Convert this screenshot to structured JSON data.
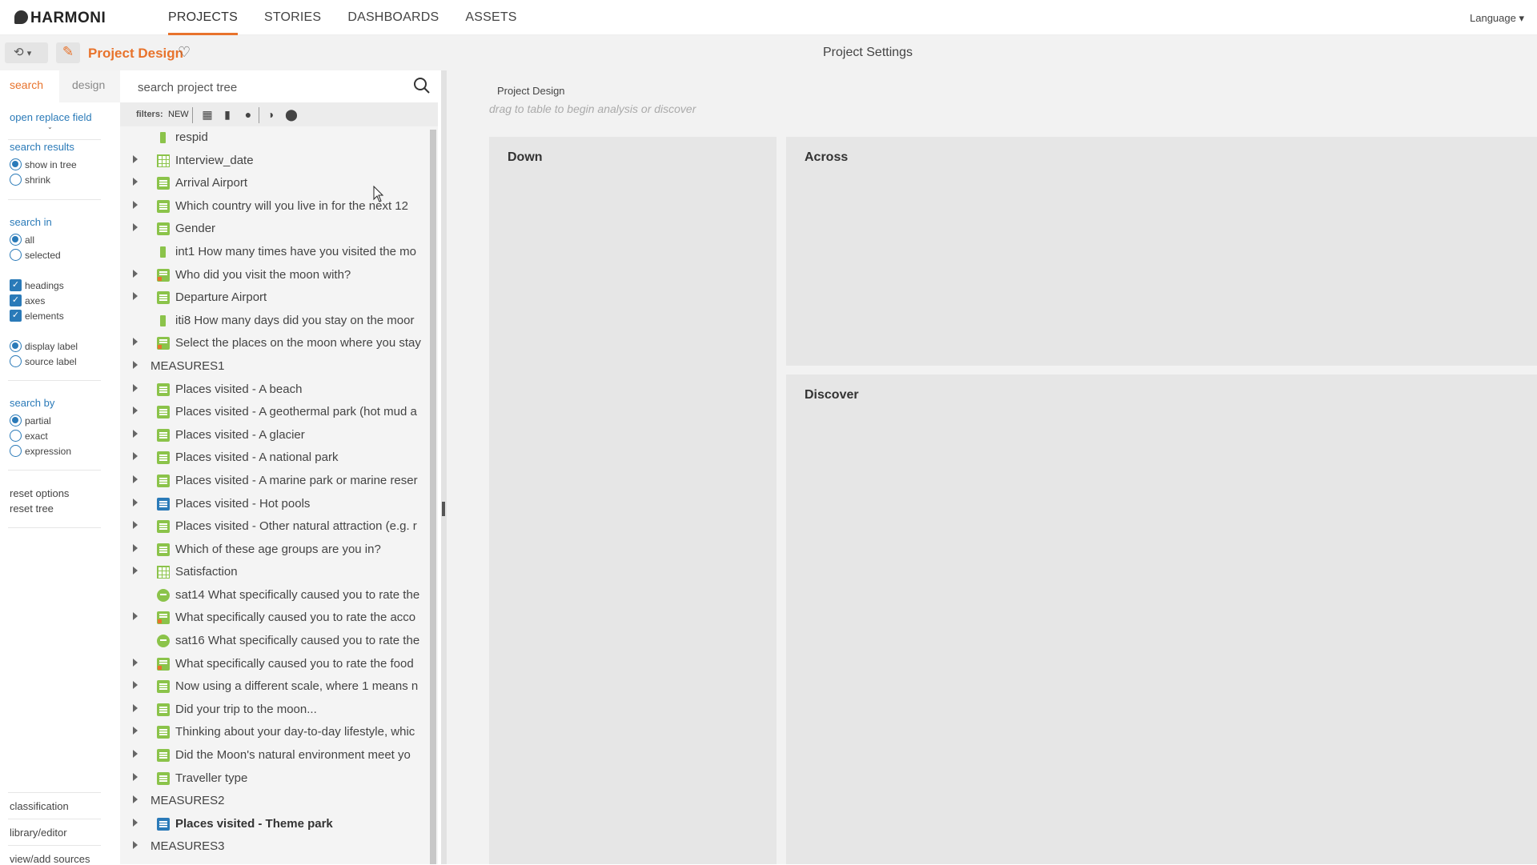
{
  "app": {
    "logo": "HARMONI",
    "language_label": "Language"
  },
  "nav": {
    "items": [
      "PROJECTS",
      "STORIES",
      "DASHBOARDS",
      "ASSETS"
    ]
  },
  "subbar": {
    "project_title": "Project Design",
    "settings_title": "Project Settings"
  },
  "left_tabs": {
    "search": "search",
    "design": "design"
  },
  "options": {
    "open_replace": "open replace field",
    "search_results_label": "search results",
    "show_in_tree": "show in tree",
    "shrink": "shrink",
    "search_in_label": "search in",
    "all": "all",
    "selected": "selected",
    "headings": "headings",
    "axes": "axes",
    "elements": "elements",
    "display_label": "display label",
    "source_label": "source label",
    "search_by_label": "search by",
    "partial": "partial",
    "exact": "exact",
    "expression": "expression",
    "reset_options": "reset options",
    "reset_tree": "reset tree",
    "classification": "classification",
    "library_editor": "library/editor",
    "view_add_sources": "view/add sources"
  },
  "tree": {
    "search_placeholder": "search project tree",
    "filters_label": "filters:",
    "filter_new": "NEW",
    "rows": [
      {
        "label": "respid",
        "icon": "number-icon",
        "arrow": false
      },
      {
        "label": "Interview_date",
        "icon": "date-grid-icon",
        "arrow": true
      },
      {
        "label": "Arrival Airport",
        "icon": "single-choice-icon",
        "arrow": true
      },
      {
        "label": "Which country will you live in for the next 12",
        "icon": "single-choice-icon",
        "arrow": true
      },
      {
        "label": "Gender",
        "icon": "single-choice-icon",
        "arrow": true
      },
      {
        "label": "int1 How many times have you visited the mo",
        "icon": "number-icon",
        "arrow": false
      },
      {
        "label": "Who did you visit the moon with?",
        "icon": "multi-choice-icon",
        "arrow": true
      },
      {
        "label": "Departure Airport",
        "icon": "single-choice-icon",
        "arrow": true
      },
      {
        "label": "iti8 How many days did you stay on the moor",
        "icon": "number-icon",
        "arrow": false
      },
      {
        "label": "Select the places on the moon where you stay",
        "icon": "multi-choice-icon",
        "arrow": true
      },
      {
        "label": "MEASURES1",
        "icon": "",
        "arrow": true,
        "group": true
      },
      {
        "label": "Places visited - A beach",
        "icon": "single-choice-icon",
        "arrow": true
      },
      {
        "label": "Places visited - A geothermal park (hot mud a",
        "icon": "single-choice-icon",
        "arrow": true
      },
      {
        "label": "Places visited - A glacier",
        "icon": "single-choice-icon",
        "arrow": true
      },
      {
        "label": "Places visited - A national park",
        "icon": "single-choice-icon",
        "arrow": true
      },
      {
        "label": "Places visited - A marine park or marine reser",
        "icon": "single-choice-icon",
        "arrow": true
      },
      {
        "label": "Places visited - Hot pools",
        "icon": "single-choice-blue-icon",
        "arrow": true
      },
      {
        "label": "Places visited - Other natural attraction (e.g. r",
        "icon": "single-choice-icon",
        "arrow": true
      },
      {
        "label": "Which of these age groups are you in?",
        "icon": "single-choice-icon",
        "arrow": true
      },
      {
        "label": "Satisfaction",
        "icon": "grid-icon",
        "arrow": true
      },
      {
        "label": "sat14 What specifically caused you to rate the",
        "icon": "text-icon",
        "arrow": false
      },
      {
        "label": "What specifically caused you to rate the acco",
        "icon": "multi-choice-icon",
        "arrow": true
      },
      {
        "label": "sat16 What specifically caused you to rate the",
        "icon": "text-icon",
        "arrow": false
      },
      {
        "label": "What specifically caused you to rate the food",
        "icon": "multi-choice-icon",
        "arrow": true
      },
      {
        "label": "Now using a different scale, where 1 means n",
        "icon": "single-choice-icon",
        "arrow": true
      },
      {
        "label": "Did your trip to the moon...",
        "icon": "single-choice-icon",
        "arrow": true
      },
      {
        "label": "Thinking about your day-to-day lifestyle, whic",
        "icon": "single-choice-icon",
        "arrow": true
      },
      {
        "label": "Did the Moon's natural environment meet yo",
        "icon": "single-choice-icon",
        "arrow": true
      },
      {
        "label": "Traveller type",
        "icon": "single-choice-icon",
        "arrow": true
      },
      {
        "label": "MEASURES2",
        "icon": "",
        "arrow": true,
        "group": true
      },
      {
        "label": "Places visited - Theme park",
        "icon": "single-choice-blue-icon",
        "arrow": true,
        "bold": true
      },
      {
        "label": "MEASURES3",
        "icon": "",
        "arrow": true,
        "group": true
      }
    ]
  },
  "main": {
    "crumb": "Project Design",
    "hint": "drag to table to begin analysis or discover",
    "down_title": "Down",
    "across_title": "Across",
    "discover_title": "Discover"
  },
  "colors": {
    "accent": "#e8732c",
    "link": "#2a7ab8",
    "icon_green": "#8bc34a"
  }
}
